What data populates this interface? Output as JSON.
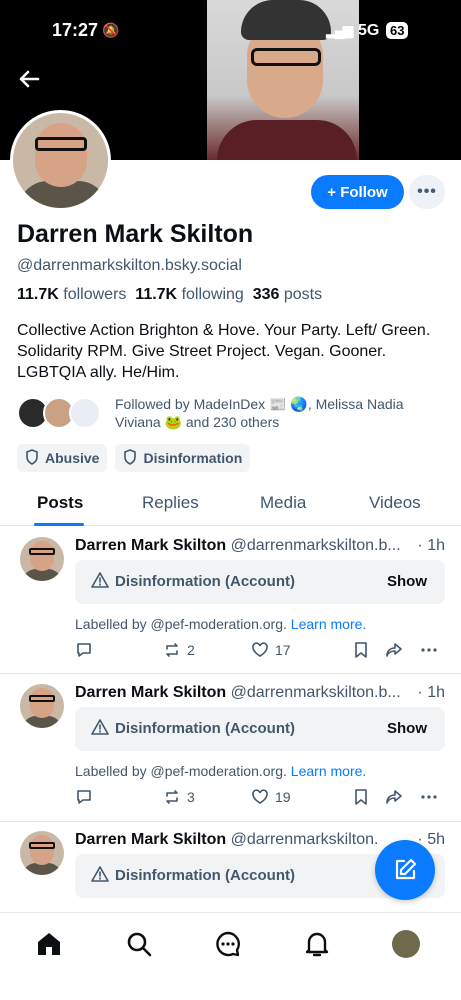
{
  "status_bar": {
    "time": "17:27",
    "network": "5G",
    "battery": "63"
  },
  "profile": {
    "name": "Darren Mark Skilton",
    "handle": "@darrenmarkskilton.bsky.social",
    "followers_count": "11.7K",
    "followers_label": "followers",
    "following_count": "11.7K",
    "following_label": "following",
    "posts_count": "336",
    "posts_label": "posts",
    "bio": "Collective Action Brighton & Hove. Your Party. Left/ Green. Solidarity RPM. Give Street Project. Vegan. Gooner. LGBTQIA ally. He/Him.",
    "followed_by": "Followed by MadeInDex 📰 🌏, Melissa Nadia Viviana 🐸 and 230 others"
  },
  "buttons": {
    "follow": "+ Follow",
    "more": "•••"
  },
  "labels": [
    {
      "label": "Abusive"
    },
    {
      "label": "Disinformation"
    }
  ],
  "tabs": [
    {
      "label": "Posts"
    },
    {
      "label": "Replies"
    },
    {
      "label": "Media"
    },
    {
      "label": "Videos"
    }
  ],
  "posts": [
    {
      "author": "Darren Mark Skilton",
      "handle": "@darrenmarkskilton.b...",
      "time": "· 1h",
      "warning": "Disinformation (Account)",
      "show": "Show",
      "labelled_by": "Labelled by @pef-moderation.org.",
      "learn_more": "Learn more.",
      "reposts": "2",
      "likes": "17"
    },
    {
      "author": "Darren Mark Skilton",
      "handle": "@darrenmarkskilton.b...",
      "time": "· 1h",
      "warning": "Disinformation (Account)",
      "show": "Show",
      "labelled_by": "Labelled by @pef-moderation.org.",
      "learn_more": "Learn more.",
      "reposts": "3",
      "likes": "19"
    },
    {
      "author": "Darren Mark Skilton",
      "handle": "@darrenmarkskilton.",
      "time": "· 5h",
      "warning": "Disinformation (Account)"
    }
  ],
  "colors": {
    "accent": "#0a7aff",
    "muted": "#42576c",
    "chip_bg": "#f1f3f5"
  }
}
